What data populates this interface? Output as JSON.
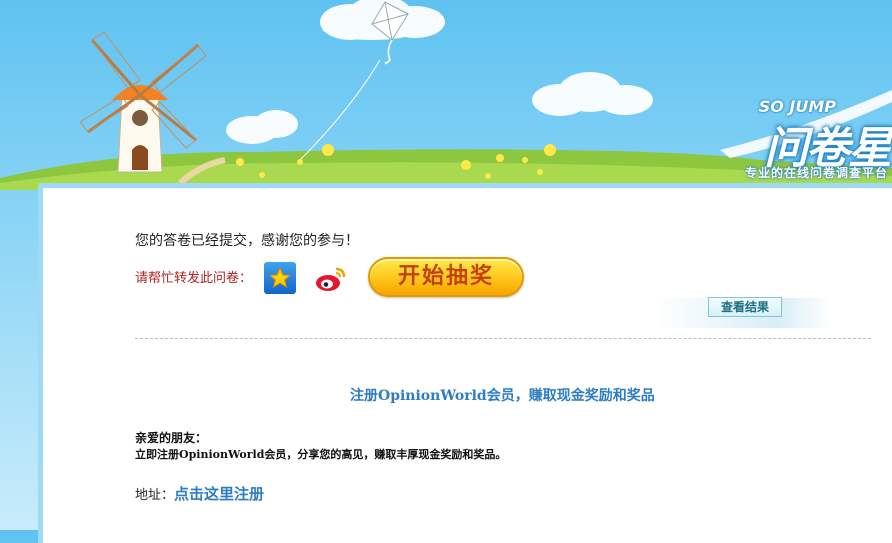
{
  "header": {
    "logo_small": "SO JUMP",
    "logo_big": "问卷星",
    "tagline": "专业的在线问卷调查平台"
  },
  "main": {
    "thanks_text": "您的答卷已经提交，感谢您的参与！",
    "share_label": "请帮忙转发此问卷：",
    "share_icons": [
      "qq-zone-icon",
      "weibo-icon"
    ],
    "lottery_button": "开始抽奖",
    "result_button": "查看结果"
  },
  "promo": {
    "title": "注册OpinionWorld会员，赚取现金奖励和奖品",
    "greeting": "亲爱的朋友：",
    "body": "立即注册OpinionWorld会员，分享您的高见，赚取丰厚现金奖励和奖品。",
    "address_label": "地址：",
    "address_link": "点击这里注册"
  },
  "colors": {
    "sky": "#5fc2f1",
    "grass": "#8dc63f",
    "link": "#2e7cc4",
    "share_label": "#b22222",
    "button_gold": "#ffc61a"
  }
}
